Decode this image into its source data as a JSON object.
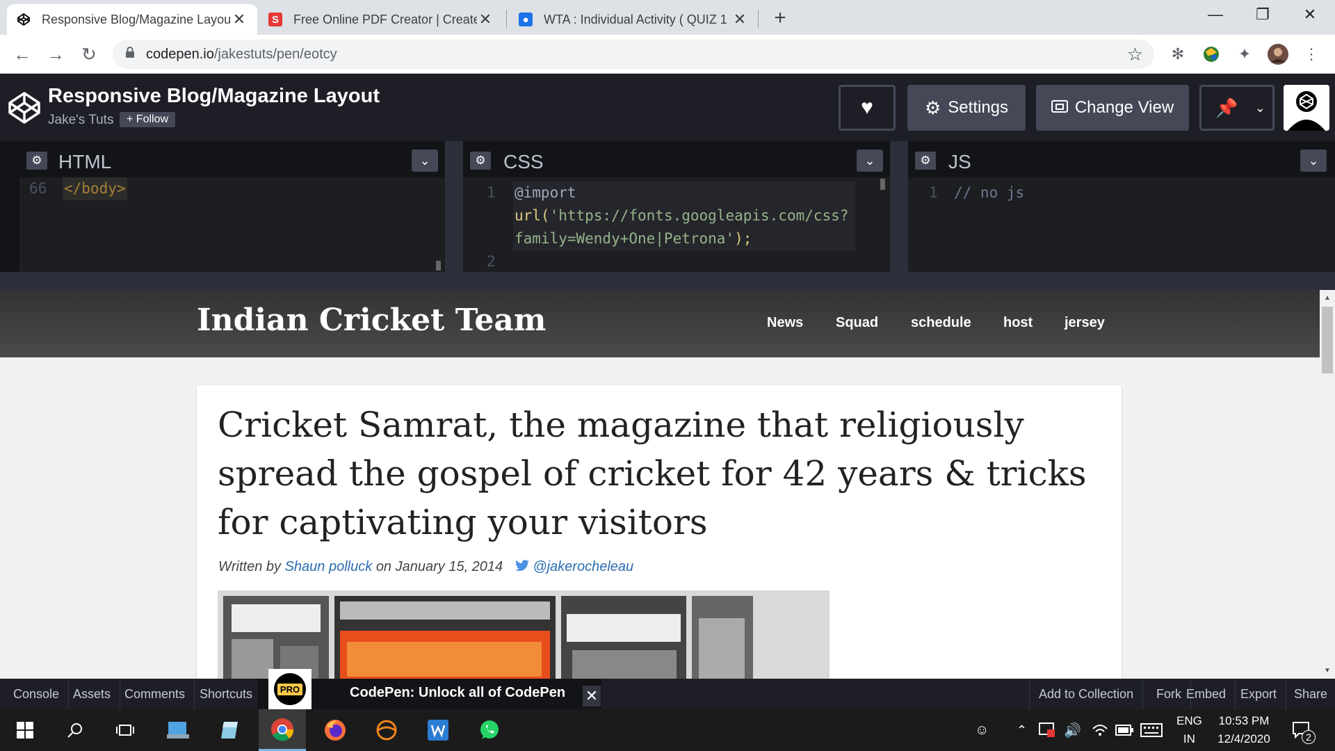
{
  "browser": {
    "tabs": [
      {
        "title": "Responsive Blog/Magazine Layou",
        "active": true
      },
      {
        "title": "Free Online PDF Creator | Create",
        "active": false
      },
      {
        "title": "WTA : Individual Activity ( QUIZ 1",
        "active": false
      }
    ],
    "new_tab": "+",
    "url_host": "codepen.io",
    "url_path": "/jakestuts/pen/eotcy"
  },
  "codepen": {
    "pen_title": "Responsive Blog/Magazine Layout",
    "author": "Jake's Tuts",
    "follow_label": "+ Follow",
    "settings_label": "Settings",
    "change_view_label": "Change View",
    "panes": {
      "html": {
        "label": "HTML",
        "line_no": "66",
        "code": "</body>"
      },
      "css": {
        "label": "CSS",
        "line1_no": "1",
        "line2_no": "2",
        "at_import": "@import",
        "url_fn": "url(",
        "url_string_a": "'https://fonts.googleapis.com/css?",
        "url_string_b": "family=Wendy+One|Petrona'",
        "url_close": ");"
      },
      "js": {
        "label": "JS",
        "line_no": "1",
        "code": "// no js"
      }
    },
    "bottom_bar": {
      "left": [
        "Console",
        "Assets",
        "Comments",
        "Shortcuts"
      ],
      "pro_badge": "PRO",
      "promo_text": "CodePen: Unlock all of CodePen",
      "right": [
        "Add to Collection",
        "Fork",
        "Embed",
        "Export",
        "Share"
      ]
    }
  },
  "preview": {
    "site_name": "Indian Cricket Team",
    "nav": [
      "News",
      "Squad",
      "schedule",
      "host",
      "jersey"
    ],
    "headline": "Cricket Samrat, the magazine that religiously spread the gospel of cricket for 42 years & tricks for captivating your visitors",
    "byline": {
      "written_by": "Written by",
      "author": "Shaun polluck",
      "on": "on January 15, 2014",
      "twitter": "@jakerocheleau"
    }
  },
  "taskbar": {
    "lang_top": "ENG",
    "lang_bottom": "IN",
    "time": "10:53 PM",
    "date": "12/4/2020",
    "notifications": "2"
  },
  "colors": {
    "codepen_bg": "#1e1f26",
    "button_bg": "#444857",
    "link_blue": "#2b6cb0"
  }
}
